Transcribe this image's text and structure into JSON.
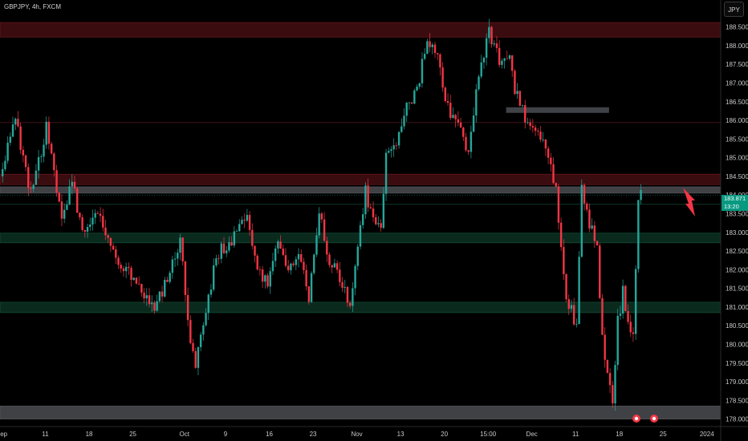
{
  "header": {
    "symbol": "GBPJPY, 4h, FXCM",
    "currency_button": "JPY"
  },
  "last_price": {
    "value": "183.871",
    "countdown": "13:20"
  },
  "colors": {
    "up": "#26a69a",
    "down": "#f23645",
    "red_zone": "#3a0c10",
    "green_zone": "#0b2a1e",
    "grey_zone": "#4a4d52",
    "arrow": "#f23645",
    "background": "#000000"
  },
  "chart_data": {
    "type": "candlestick",
    "title": "",
    "symbol": "GBPJPY",
    "timeframe": "4h",
    "x_ticks": [
      "Sep",
      "11",
      "18",
      "25",
      "Oct",
      "9",
      "16",
      "23",
      "Nov",
      "13",
      "20",
      "15:00",
      "Dec",
      "11",
      "18",
      "25",
      "2024"
    ],
    "x_tick_index": [
      0,
      17,
      34,
      51,
      71,
      87,
      104,
      121,
      138,
      155,
      172,
      189,
      206,
      223,
      240,
      257,
      274
    ],
    "y_ticks": [
      178.0,
      178.5,
      179.0,
      179.5,
      180.0,
      180.5,
      181.0,
      181.5,
      182.0,
      182.5,
      183.0,
      183.5,
      184.0,
      184.5,
      185.0,
      185.5,
      186.0,
      186.5,
      187.0,
      187.5,
      188.0,
      188.5
    ],
    "y_tick_labels": [
      "178.000",
      "178.500",
      "179.000",
      "179.500",
      "180.000",
      "180.500",
      "181.000",
      "181.500",
      "182.000",
      "182.500",
      "183.000",
      "183.500",
      "184.000",
      "184.500",
      "185.000",
      "185.500",
      "186.000",
      "186.500",
      "187.000",
      "187.500",
      "188.000",
      "188.500"
    ],
    "ylim": [
      177.8,
      188.75
    ],
    "path": [
      [
        0,
        184.5
      ],
      [
        6,
        186.0
      ],
      [
        12,
        184.0
      ],
      [
        18,
        185.8
      ],
      [
        24,
        183.3
      ],
      [
        28,
        184.4
      ],
      [
        32,
        183.0
      ],
      [
        38,
        183.5
      ],
      [
        44,
        182.4
      ],
      [
        50,
        181.9
      ],
      [
        56,
        181.4
      ],
      [
        60,
        181.0
      ],
      [
        64,
        181.6
      ],
      [
        68,
        182.3
      ],
      [
        70,
        182.9
      ],
      [
        74,
        180.0
      ],
      [
        76,
        179.5
      ],
      [
        80,
        180.8
      ],
      [
        84,
        182.4
      ],
      [
        90,
        182.8
      ],
      [
        96,
        183.6
      ],
      [
        100,
        182.0
      ],
      [
        104,
        181.6
      ],
      [
        108,
        182.7
      ],
      [
        112,
        181.9
      ],
      [
        116,
        182.5
      ],
      [
        120,
        181.2
      ],
      [
        124,
        183.5
      ],
      [
        128,
        182.2
      ],
      [
        132,
        181.8
      ],
      [
        136,
        181.0
      ],
      [
        139,
        182.6
      ],
      [
        142,
        184.1
      ],
      [
        145,
        183.3
      ],
      [
        148,
        183.0
      ],
      [
        150,
        185.0
      ],
      [
        154,
        185.5
      ],
      [
        158,
        186.4
      ],
      [
        162,
        186.8
      ],
      [
        166,
        188.2
      ],
      [
        170,
        187.6
      ],
      [
        174,
        186.3
      ],
      [
        178,
        185.8
      ],
      [
        182,
        185.2
      ],
      [
        186,
        187.3
      ],
      [
        190,
        188.4
      ],
      [
        194,
        187.6
      ],
      [
        198,
        187.9
      ],
      [
        200,
        186.8
      ],
      [
        204,
        186.1
      ],
      [
        208,
        185.7
      ],
      [
        212,
        185.3
      ],
      [
        216,
        184.1
      ],
      [
        220,
        181.3
      ],
      [
        224,
        180.5
      ],
      [
        226,
        184.1
      ],
      [
        228,
        183.5
      ],
      [
        232,
        182.6
      ],
      [
        234,
        180.1
      ],
      [
        238,
        178.5
      ],
      [
        240,
        180.6
      ],
      [
        242,
        181.4
      ],
      [
        244,
        180.5
      ],
      [
        246,
        180.2
      ],
      [
        248,
        184.0
      ]
    ],
    "zones": [
      {
        "kind": "resistance",
        "color": "red",
        "from": 188.23,
        "to": 188.62
      },
      {
        "kind": "resistance",
        "color": "red",
        "from": 184.28,
        "to": 184.56
      },
      {
        "kind": "level",
        "color": "grey",
        "from": 184.05,
        "to": 184.22
      },
      {
        "kind": "support",
        "color": "green",
        "from": 182.72,
        "to": 182.98
      },
      {
        "kind": "support",
        "color": "green",
        "from": 180.85,
        "to": 181.13
      },
      {
        "kind": "support",
        "color": "grey",
        "from": 178.0,
        "to": 178.35
      }
    ],
    "annotations": [
      {
        "type": "arrow",
        "direction": "down",
        "color": "red"
      }
    ]
  }
}
